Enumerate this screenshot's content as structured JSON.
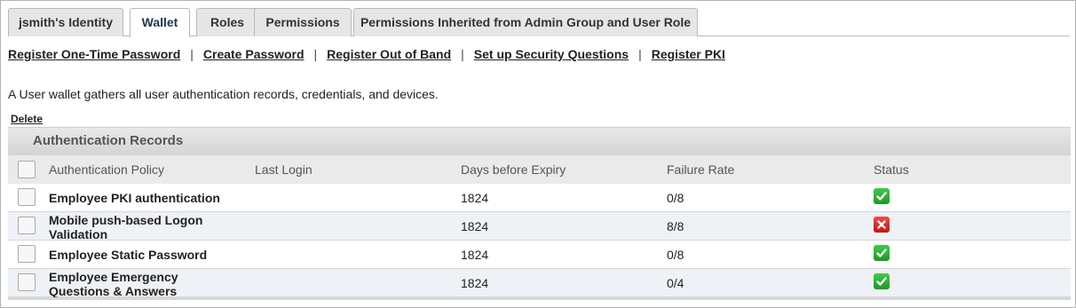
{
  "tabs": [
    {
      "label": "jsmith's Identity",
      "active": false
    },
    {
      "label": "Wallet",
      "active": true
    },
    {
      "label": "Roles",
      "active": false
    },
    {
      "label": "Permissions",
      "active": false
    },
    {
      "label": "Permissions Inherited from Admin Group and User Role",
      "active": false
    }
  ],
  "actions": [
    "Register One-Time Password",
    "Create Password",
    "Register Out of Band",
    "Set up Security Questions",
    "Register PKI"
  ],
  "action_separator": "|",
  "description": "A User wallet gathers all user authentication records, credentials, and devices.",
  "delete_label": "Delete",
  "records": {
    "title": "Authentication Records",
    "columns": [
      "Authentication Policy",
      "Last Login",
      "Days before Expiry",
      "Failure Rate",
      "Status"
    ],
    "rows": [
      {
        "policy": "Employee PKI authentication",
        "last_login": "",
        "days_before_expiry": "1824",
        "failure_rate": "0/8",
        "status": "ok"
      },
      {
        "policy": "Mobile push-based Logon Validation",
        "last_login": "",
        "days_before_expiry": "1824",
        "failure_rate": "8/8",
        "status": "failed"
      },
      {
        "policy": "Employee Static Password",
        "last_login": "",
        "days_before_expiry": "1824",
        "failure_rate": "0/8",
        "status": "ok"
      },
      {
        "policy": "Employee Emergency Questions & Answers",
        "last_login": "",
        "days_before_expiry": "1824",
        "failure_rate": "0/4",
        "status": "ok"
      }
    ]
  },
  "colors": {
    "status_ok": "#2bb335",
    "status_failed": "#d92424",
    "row_alt": "#eef1f5"
  }
}
